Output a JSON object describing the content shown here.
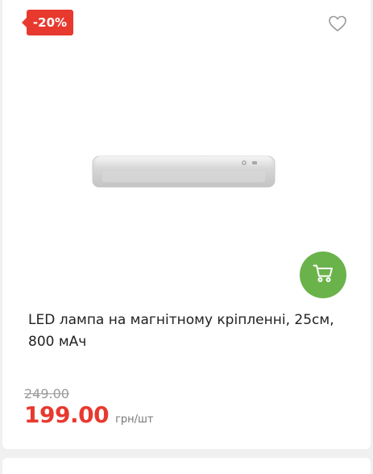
{
  "product": {
    "discount_badge": "-20%",
    "title": "LED лампа на магнітному кріпленні, 25см, 800 мАч",
    "old_price": "249.00",
    "price": "199.00",
    "unit": "грн/шт"
  },
  "icons": {
    "wishlist": "heart-outline-icon",
    "cart": "cart-icon"
  },
  "colors": {
    "discount": "#e8392f",
    "cart_button": "#6ab34a",
    "price": "#e8392f"
  }
}
